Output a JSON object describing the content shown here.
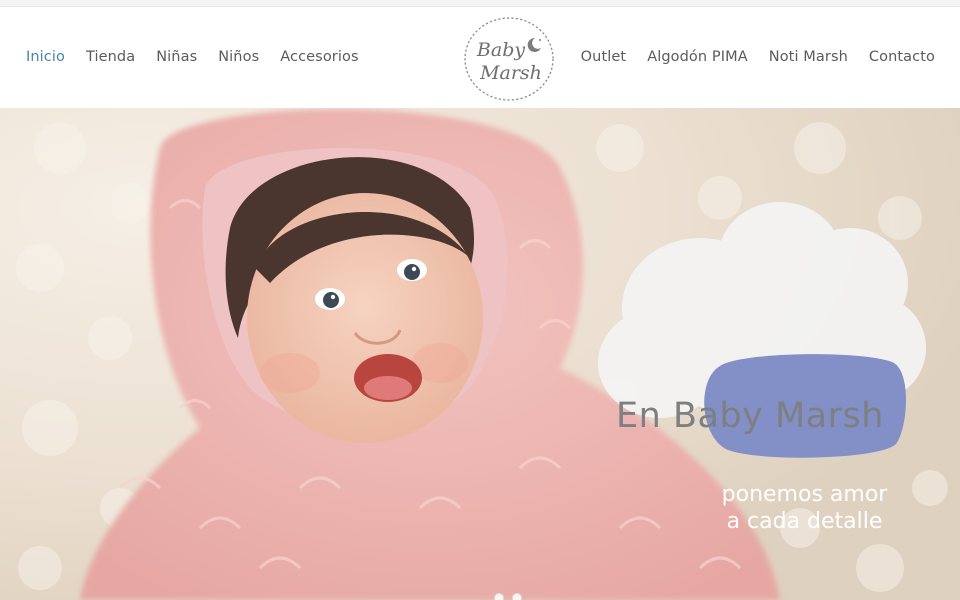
{
  "nav_left": [
    {
      "label": "Inicio",
      "active": true
    },
    {
      "label": "Tienda"
    },
    {
      "label": "Niñas"
    },
    {
      "label": "Niños"
    },
    {
      "label": "Accesorios"
    }
  ],
  "nav_right": [
    {
      "label": "Outlet"
    },
    {
      "label": "Algodón PIMA"
    },
    {
      "label": "Noti Marsh"
    },
    {
      "label": "Contacto"
    }
  ],
  "logo": {
    "line1": "Baby",
    "line2": "Marsh"
  },
  "hero": {
    "headline": "En Baby Marsh",
    "subline_1": "ponemos amor",
    "subline_2": "a cada detalle"
  },
  "slider": {
    "slide_count": 2,
    "active_index": 0
  },
  "colors": {
    "active_nav": "#4a86a8",
    "nav_text": "#5b5b5b",
    "bubble": "#8290c7",
    "cloud": "#f3f3f3",
    "headline": "#7d7f80"
  }
}
